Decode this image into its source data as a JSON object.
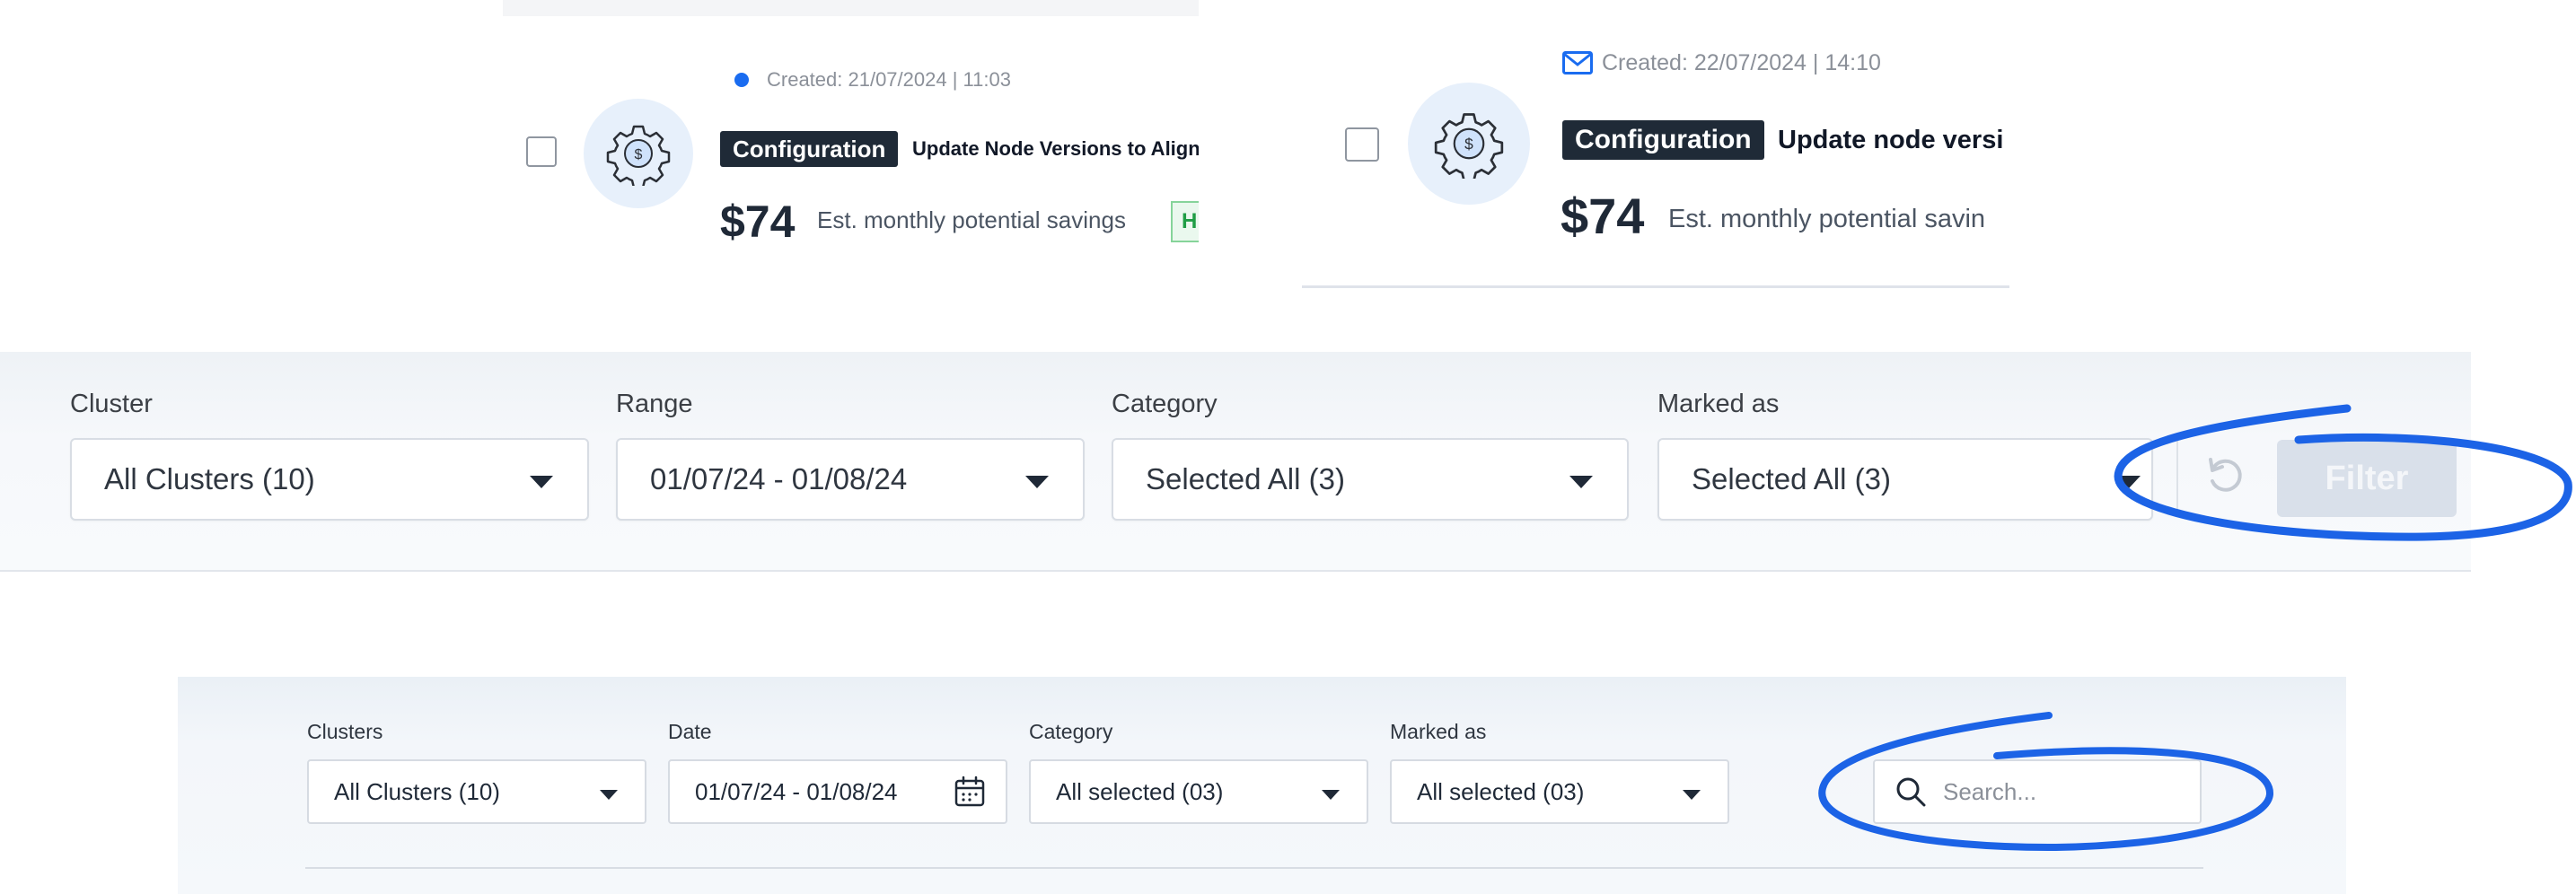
{
  "cards": [
    {
      "created": "Created: 21/07/2024  | 11:03",
      "tag": "Configuration",
      "title": "Update Node Versions to Align",
      "price": "$74",
      "savings": "Est. monthly potential savings",
      "badge": "H"
    },
    {
      "created": "Created: 22/07/2024  | 14:10",
      "tag": "Configuration",
      "title": "Update node versi",
      "price": "$74",
      "savings": "Est. monthly potential savin"
    }
  ],
  "filter_bar_1": {
    "cluster": {
      "label": "Cluster",
      "value": "All Clusters (10)"
    },
    "range": {
      "label": "Range",
      "value": "01/07/24 - 01/08/24"
    },
    "category": {
      "label": "Category",
      "value": "Selected All  (3)"
    },
    "marked_as": {
      "label": "Marked as",
      "value": "Selected All  (3)"
    },
    "filter_button": "Filter"
  },
  "filter_bar_2": {
    "clusters": {
      "label": "Clusters",
      "value": "All Clusters (10)"
    },
    "date": {
      "label": "Date",
      "value": "01/07/24 - 01/08/24"
    },
    "category": {
      "label": "Category",
      "value": "All selected (03)"
    },
    "marked_as": {
      "label": "Marked as",
      "value": "All selected (03)"
    },
    "search_placeholder": "Search..."
  },
  "colors": {
    "accent_blue": "#1a6cf0",
    "annotation_blue": "#1c63e6",
    "tag_dark": "#1f2a37",
    "filter_disabled": "#d9e0ea"
  },
  "icons": [
    "gear-dollar-icon",
    "mail-icon",
    "caret-down-icon",
    "reset-icon",
    "calendar-icon",
    "search-icon"
  ]
}
